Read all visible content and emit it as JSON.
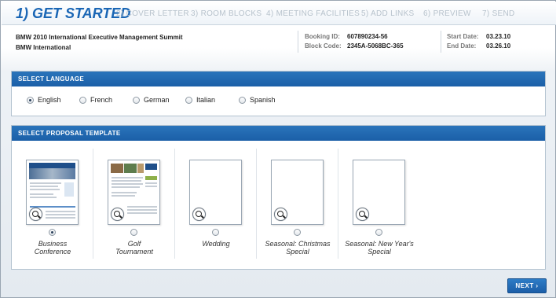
{
  "steps": [
    "1) GET STARTED",
    "2) COVER LETTER",
    "3) ROOM BLOCKS",
    "4) MEETING FACILITIES",
    "5) ADD LINKS",
    "6) PREVIEW",
    "7) SEND"
  ],
  "event": {
    "name": "BMW 2010 International Executive Management Summit",
    "org": "BMW International"
  },
  "booking": {
    "id_label": "Booking ID:",
    "id_value": "607890234-56",
    "block_label": "Block Code:",
    "block_value": "2345A-5068BC-365"
  },
  "dates": {
    "start_label": "Start Date:",
    "start_value": "03.23.10",
    "end_label": "End Date:",
    "end_value": "03.26.10"
  },
  "language": {
    "title": "SELECT LANGUAGE",
    "options": [
      "English",
      "French",
      "German",
      "Italian",
      "Spanish"
    ],
    "selected": "English"
  },
  "template": {
    "title": "SELECT PROPOSAL TEMPLATE",
    "options": [
      {
        "line1": "Business",
        "line2": "Conference"
      },
      {
        "line1": "Golf",
        "line2": "Tournament"
      },
      {
        "line1": "Wedding",
        "line2": ""
      },
      {
        "line1": "Seasonal: Christmas",
        "line2": "Special"
      },
      {
        "line1": "Seasonal: New Year's",
        "line2": "Special"
      }
    ],
    "selected": "Business Conference"
  },
  "next_label": "NEXT ›",
  "colors": {
    "accent": "#1a66b5",
    "header": "#1b5fa8"
  },
  "icons": {
    "zoom": "magnifier-icon",
    "next": "chevron-right-icon"
  }
}
